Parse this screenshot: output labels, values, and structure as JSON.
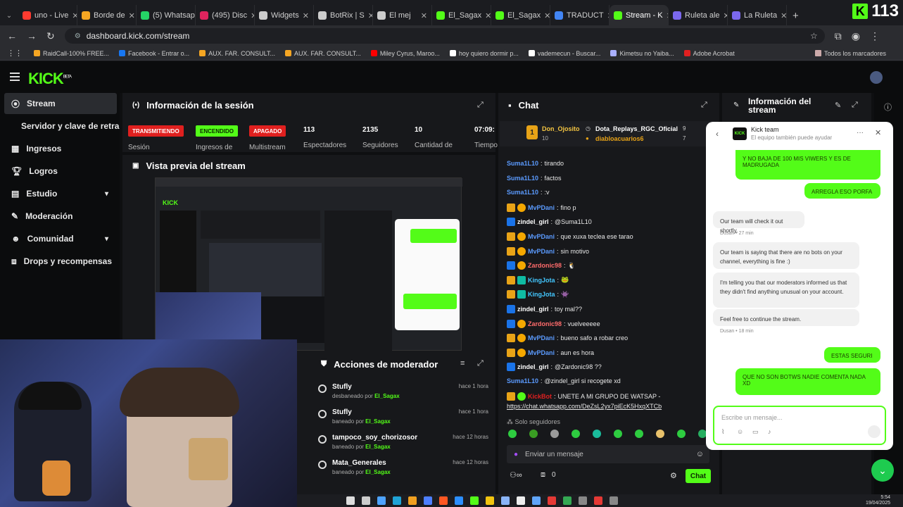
{
  "browser": {
    "tabs": [
      {
        "label": "uno - Live",
        "color": "#ff3b30"
      },
      {
        "label": "Borde de",
        "color": "#f5a623"
      },
      {
        "label": "(5) Whatsap",
        "color": "#25d366"
      },
      {
        "label": "(495) Disc",
        "color": "#e0245e"
      },
      {
        "label": "Widgets",
        "color": "#cccccc"
      },
      {
        "label": "BotRix | S",
        "color": "#cccccc"
      },
      {
        "label": "El mej",
        "color": "#cccccc"
      },
      {
        "label": "El_Sagax",
        "color": "#53fc18"
      },
      {
        "label": "El_Sagax",
        "color": "#53fc18"
      },
      {
        "label": "TRADUCT",
        "color": "#4285f4"
      },
      {
        "label": "Stream - K",
        "color": "#53fc18"
      },
      {
        "label": "Ruleta ale",
        "color": "#7b68ee"
      },
      {
        "label": "La Ruleta",
        "color": "#7b68ee"
      }
    ],
    "viewer_count": "113",
    "url": "dashboard.kick.com/stream",
    "bookmarks": [
      {
        "label": "RaidCall-100% FREE...",
        "color": "#f5a623"
      },
      {
        "label": "Facebook - Entrar o...",
        "color": "#1877f2"
      },
      {
        "label": "AUX. FAR. CONSULT...",
        "color": "#f5a623"
      },
      {
        "label": "AUX. FAR. CONSULT...",
        "color": "#f5a623"
      },
      {
        "label": "Miley Cyrus, Maroo...",
        "color": "#ff0000"
      },
      {
        "label": "hoy quiero dormir p...",
        "color": "#ffffff"
      },
      {
        "label": "vademecun - Buscar...",
        "color": "#ffffff"
      },
      {
        "label": "Kimetsu no Yaiba...",
        "color": "#aab0ff"
      },
      {
        "label": "Adobe Acrobat",
        "color": "#e02020"
      }
    ],
    "all_bookmarks": "Todos los marcadores"
  },
  "kick": {
    "logo": "KICK",
    "logo_sup": "BETA"
  },
  "sidebar": {
    "items": [
      {
        "label": "Stream"
      },
      {
        "label": "Servidor y clave de retransmisión"
      },
      {
        "label": "Ingresos"
      },
      {
        "label": "Logros"
      },
      {
        "label": "Estudio"
      },
      {
        "label": "Moderación"
      },
      {
        "label": "Comunidad"
      },
      {
        "label": "Drops y recompensas"
      }
    ]
  },
  "session": {
    "title": "Información de la sesión",
    "pills": [
      {
        "label": "TRANSMITIENDO",
        "status_label": "Sesión",
        "bg": "#e0201f",
        "fg": "#ffffff"
      },
      {
        "label": "ENCENDIDO",
        "status_label": "Ingresos de",
        "bg": "#53fc18",
        "fg": "#0b2a00"
      },
      {
        "label": "APAGADO",
        "status_label": "Multistream",
        "bg": "#e0201f",
        "fg": "#ffffff"
      }
    ],
    "stats": [
      {
        "value": "113",
        "label": "Espectadores"
      },
      {
        "value": "2135",
        "label": "Seguidores"
      },
      {
        "value": "10",
        "label": "Cantidad de"
      },
      {
        "value": "07:09:",
        "label": "Tiempo"
      }
    ]
  },
  "preview": {
    "title": "Vista previa del stream"
  },
  "moderator": {
    "title": "Acciones de moderador",
    "rows": [
      {
        "name": "Stufly",
        "action": "desbaneado por",
        "by": "El_Sagax",
        "time": "hace 1 hora"
      },
      {
        "name": "Stufly",
        "action": "baneado por",
        "by": "El_Sagax",
        "time": "hace 1 hora"
      },
      {
        "name": "tampoco_soy_chorizosor",
        "action": "baneado por",
        "by": "El_Sagax",
        "time": "hace 12 horas"
      },
      {
        "name": "Mata_Generales",
        "action": "baneado por",
        "by": "El_Sagax",
        "time": "hace 12 horas"
      }
    ]
  },
  "chat": {
    "title": "Chat",
    "pinned": {
      "rank": "1",
      "user1": "Don_Ojosito",
      "user1_count": "10",
      "user2": "Dota_Replays_RGC_Oficial",
      "user2_count": "9",
      "user3": "diabloacuarios6",
      "user3_count": "7"
    },
    "messages": [
      {
        "user": "Suma1L10",
        "color": "#5b9bff",
        "badges": [],
        "text": "tirando"
      },
      {
        "user": "Suma1L10",
        "color": "#5b9bff",
        "badges": [],
        "text": "factos"
      },
      {
        "user": "Suma1L10",
        "color": "#5b9bff",
        "badges": [],
        "text": ":v"
      },
      {
        "user": "MvPDani",
        "color": "#5b9bff",
        "badges": [
          "crown",
          "og"
        ],
        "text": "fino p"
      },
      {
        "user": "zindel_girl",
        "color": "#ffffff",
        "badges": [
          "blue"
        ],
        "text": "@Suma1L10"
      },
      {
        "user": "MvPDani",
        "color": "#5b9bff",
        "badges": [
          "crown",
          "og"
        ],
        "text": "que xuxa teclea ese tarao"
      },
      {
        "user": "MvPDani",
        "color": "#5b9bff",
        "badges": [
          "crown",
          "og"
        ],
        "text": "sin motivo"
      },
      {
        "user": "Zardonic98",
        "color": "#ff6b6b",
        "badges": [
          "blue",
          "og"
        ],
        "text": "🐧"
      },
      {
        "user": "KingJota",
        "color": "#43c7ff",
        "badges": [
          "crown",
          "teal"
        ],
        "text": "🐸"
      },
      {
        "user": "KingJota",
        "color": "#43c7ff",
        "badges": [
          "crown",
          "teal"
        ],
        "text": "👾"
      },
      {
        "user": "zindel_girl",
        "color": "#ffffff",
        "badges": [
          "blue"
        ],
        "text": "toy mal??"
      },
      {
        "user": "Zardonic98",
        "color": "#ff6b6b",
        "badges": [
          "blue",
          "og"
        ],
        "text": "vuelveeeee"
      },
      {
        "user": "MvPDani",
        "color": "#5b9bff",
        "badges": [
          "crown",
          "og"
        ],
        "text": "bueno safo a robar creo"
      },
      {
        "user": "MvPDani",
        "color": "#5b9bff",
        "badges": [
          "crown",
          "og"
        ],
        "text": "aun es hora"
      },
      {
        "user": "zindel_girl",
        "color": "#ffffff",
        "badges": [
          "blue"
        ],
        "text": "@Zardonic98 ??"
      },
      {
        "user": "Suma1L10",
        "color": "#5b9bff",
        "badges": [],
        "text": "@zindel_girl si recogete xd"
      },
      {
        "user": "KickBot",
        "color": "#e02020",
        "badges": [
          "crown",
          "green"
        ],
        "text": "UNETE A MI GRUPO DE WATSAP -"
      }
    ],
    "link": "https://chat.whatsapp.com/DeZsL2yx7piEcK5HxqXTCb",
    "followers_only": "Solo seguidores",
    "input_placeholder": "Enviar un mensaje",
    "footer_count": "0",
    "send_label": "Chat"
  },
  "stream_info": {
    "title": "Información del stream"
  },
  "support": {
    "team": "Kick team",
    "subtitle": "El equipo también puede ayudar",
    "messages": [
      {
        "from": "me",
        "text": "Y NO BAJA DE 100 MIS VIWERS Y ES DE MADRUGADA"
      },
      {
        "from": "me",
        "text": "ARREGLA ESO PORFA"
      },
      {
        "from": "them",
        "text": "Our team will check it out shortly."
      },
      {
        "from": "meta",
        "text": "Dusan • 27 min"
      },
      {
        "from": "them",
        "text": "Our team is saying that there are no bots on your channel, everything is fine :)"
      },
      {
        "from": "them",
        "text": "I'm telling you that our moderators informed us that they didn't find anything unusual on your account."
      },
      {
        "from": "them",
        "text": "Feel free to continue the stream."
      },
      {
        "from": "meta",
        "text": "Dusan • 18 min"
      },
      {
        "from": "me",
        "text": "ESTAS SEGURI"
      },
      {
        "from": "me",
        "text": "QUE NO SON BOTWS NADIE COMENTA NADA XD"
      }
    ],
    "input_placeholder": "Escribe un mensaje..."
  },
  "taskbar": {
    "time": "5:54",
    "date": "19/04/2025"
  }
}
